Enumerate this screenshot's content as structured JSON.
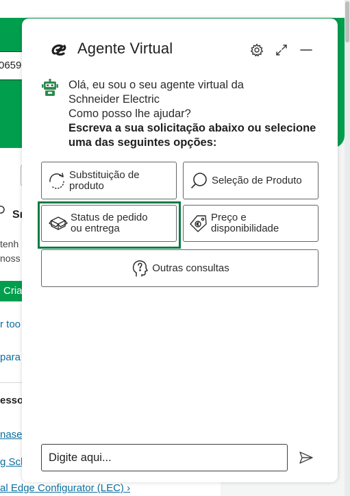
{
  "background": {
    "input_fragment": "0659",
    "heading_fragment": "Sı",
    "line1": "tenh",
    "line2": "noss",
    "button_fragment": "Cria",
    "link1": "r too",
    "link2": "para",
    "section_fragment": "esso",
    "link3": "nase",
    "link4": "g Sch",
    "bottom_link": "al Edge Configurator (LEC)"
  },
  "header": {
    "title": "Agente Virtual",
    "icons": [
      "ev-logo-icon",
      "gear-icon",
      "expand-icon",
      "minimize-icon"
    ]
  },
  "greeting": {
    "line1": "Olá, eu sou o seu agente virtual da",
    "line2": "Schneider Electric",
    "line3": "Como posso lhe ajudar?",
    "bold": "Escreva a sua solicitação abaixo ou selecione uma das seguintes opções:"
  },
  "options": [
    {
      "label": "Substituição de produto",
      "icon": "refresh-icon"
    },
    {
      "label": "Seleção de Produto",
      "icon": "search-icon"
    },
    {
      "label": "Status de pedido ou entrega",
      "icon": "package-icon"
    },
    {
      "label": "Preço e disponibilidade",
      "icon": "price-tag-icon"
    },
    {
      "label": "Outras consultas",
      "icon": "head-question-icon"
    }
  ],
  "composer": {
    "placeholder": "Digite aqui..."
  },
  "colors": {
    "brand_green": "#009e4d",
    "focus_green": "#0b7a43",
    "border_gray": "#626469"
  }
}
